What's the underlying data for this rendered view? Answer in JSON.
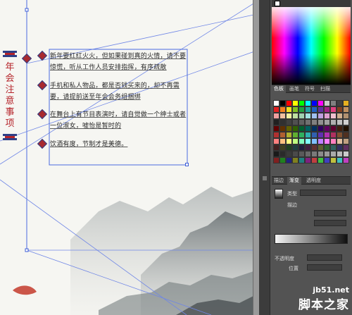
{
  "document": {
    "title_vertical": "年会注意事项",
    "bullets": [
      {
        "glyph": "◆",
        "text": "新年要红红火火，但如果碰到真的火情，请不要惊慌，听从工作人员安排指挥，有序疏散"
      },
      {
        "glyph": "◆",
        "text": "手机和私人物品，都是否钱买来的，却不再需要，请提前送至年会会务组捆绑"
      },
      {
        "glyph": "◆",
        "text": "在舞台上有节目表演时，请自觉做一个绅士或者一位淑女，嘘怡是暂时的"
      },
      {
        "glyph": "◆",
        "text": "饮酒有度，节制才是美德。"
      }
    ]
  },
  "panel": {
    "swatch_tabs": [
      "色板",
      "画笔",
      "符号",
      "扫描"
    ],
    "gradient_tabs": [
      "描边",
      "渐变",
      "透明度"
    ],
    "gradient": {
      "type_label": "类型",
      "stroke_label": "描边",
      "opacity_label": "不透明度",
      "location_label": "位置"
    }
  },
  "watermark": {
    "url": "jb51.net",
    "site": "脚本之家"
  },
  "colors": {
    "accent_red": "#b5242a",
    "accent_blue": "#2f3f86",
    "selection_blue": "#3f5fd8",
    "panel_bg": "#535353"
  }
}
